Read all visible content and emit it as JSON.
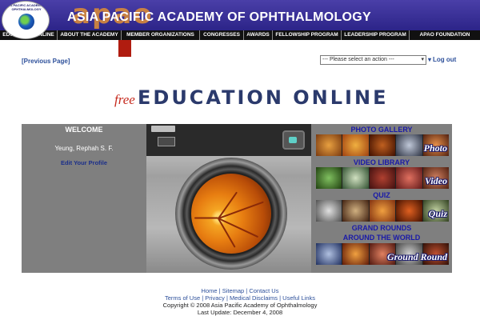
{
  "header": {
    "logo_text": "ASIA PACIFIC ACADEMY OF OPHTHALMOLOGY",
    "brand_word": "apao",
    "title": "ASIA PACIFIC ACADEMY OF OPHTHALMOLOGY"
  },
  "nav": {
    "items": [
      {
        "label": "EDUCATION ONLINE"
      },
      {
        "label": "ABOUT THE ACADEMY"
      },
      {
        "label": "MEMBER ORGANIZATIONS"
      },
      {
        "label": "CONGRESSES"
      },
      {
        "label": "AWARDS"
      },
      {
        "label": "FELLOWSHIP PROGRAM"
      },
      {
        "label": "LEADERSHIP PROGRAM"
      },
      {
        "label": "APAO FOUNDATION"
      }
    ]
  },
  "utility": {
    "previous_page": "[Previous Page]",
    "action_select_value": "--- Please select an action ---",
    "logout": "Log out"
  },
  "page": {
    "free_word": "free",
    "title": "EDUCATION ONLINE"
  },
  "welcome": {
    "title": "WELCOME",
    "user_name": "Yeung, Rephah S. F.",
    "edit_profile": "Edit Your Profile"
  },
  "sections": {
    "photo": {
      "title": "PHOTO GALLERY",
      "label": "Photo"
    },
    "video": {
      "title": "VIDEO LIBRARY",
      "label": "Video"
    },
    "quiz": {
      "title": "QUIZ",
      "label": "Quiz"
    },
    "grand_rounds": {
      "title_line1": "GRAND ROUNDS",
      "title_line2": "AROUND THE WORLD",
      "label": "Ground Round"
    }
  },
  "footer": {
    "home": "Home",
    "sitemap": "Sitemap",
    "contact": "Contact Us",
    "terms": "Terms of Use",
    "privacy": "Privacy",
    "disclaims": "Medical Disclaims",
    "useful_links": "Useful Links",
    "copyright": "Copyright © 2008 Asia Pacific Academy of Ophthalmology",
    "last_update": "Last Update: December 4, 2008"
  },
  "colors": {
    "header_bg": "#2c2488",
    "nav_bg": "#111111",
    "accent_red": "#b01c10",
    "link_blue": "#2c4f9a",
    "section_title_blue": "#1a1aa8",
    "panel_gray": "#7f7f7f"
  }
}
